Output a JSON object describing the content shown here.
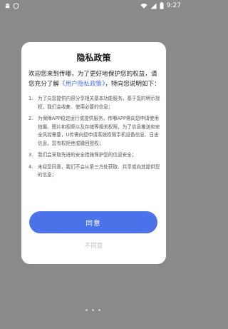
{
  "status_bar": {
    "time": "9:27",
    "icons": [
      "android-robot-icon",
      "shield-app-icon",
      "wifi-icon",
      "signal-icon",
      "battery-icon"
    ]
  },
  "dialog": {
    "title": "隐私政策",
    "intro_part1": "欢迎您来到传嘟，为了更好地保护您的权益，请您充分了解",
    "intro_link": "《用户隐私政策》",
    "intro_part2": "，特向您说明如下：",
    "clauses": [
      {
        "num": "1.",
        "text": "为了向您提供内容分享相关基本功能服务，基于您的明示授权，我们会收集、使用必要的信息；"
      },
      {
        "num": "2.",
        "text": "为保障APP稳定运行或提供服务，传嘟APP需向您申请使用拍摄、图片和视频以及存储等相关权限，为了信息推送和安全风控需要，U传需向您申请系统权限手机设备信息、日志信息，您有权拒绝或撤回授权；"
      },
      {
        "num": "3.",
        "text": "我们会采取先进的安全措施保护您的信息安全；"
      },
      {
        "num": "4.",
        "text": "未经您同意，我们不会从第三方处获取、共享或向其提供您的信息；"
      }
    ],
    "agree_label": "同意",
    "disagree_label": "不同意"
  },
  "colors": {
    "accent": "#4b72e8",
    "overlay": "#8a8a8a"
  }
}
